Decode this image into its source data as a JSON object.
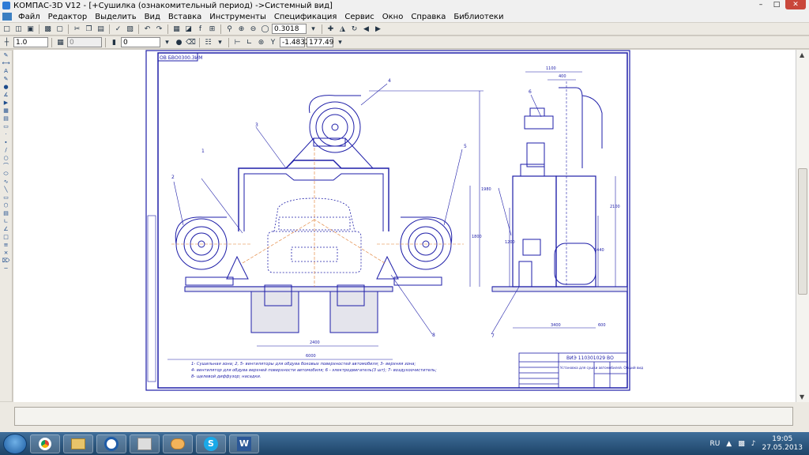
{
  "window": {
    "title": "КОМПАС-3D V12 - [+Сушилка (ознакомительный период) ->Системный вид]"
  },
  "menu": [
    "Файл",
    "Редактор",
    "Выделить",
    "Вид",
    "Вставка",
    "Инструменты",
    "Спецификация",
    "Сервис",
    "Окно",
    "Справка",
    "Библиотеки"
  ],
  "toolbar": {
    "zoom_value": "0.3018"
  },
  "properties_bar": {
    "step_value": "1.0",
    "layer_value": "0",
    "style_value": "0",
    "coord_x": "-1.4832",
    "coord_y": "177.49"
  },
  "drawing": {
    "stamp_code": "ВИЭ 110301029 ВО",
    "corner_code": "ОВ БВО0300.ЗИМ",
    "dims": [
      "1100",
      "400",
      "2100",
      "1440",
      "2400",
      "6000",
      "1980",
      "1800",
      "1200",
      "600",
      "3400"
    ],
    "callouts": [
      "1",
      "2",
      "3",
      "4",
      "5",
      "6",
      "7",
      "8"
    ],
    "notes": [
      "1- Сушильная зона; 2, 5- вентиляторы для обдува боковых поверхностей автомобиля; 3- верхняя зона;",
      "4- вентилятор для обдува верхней поверхности автомобиля; 6 - электродвигатель(3 шт); 7- воздухоочиститель;",
      "8- щелевой диффузор; насадки."
    ],
    "title_block_name": "Установка для сушки автомобилей. Общий вид"
  },
  "taskbar": {
    "apps": [
      "chrome",
      "explorer",
      "kompas",
      "hp",
      "paint",
      "skype",
      "word"
    ],
    "language": "RU",
    "time": "19:05",
    "date": "27.05.2013"
  },
  "colors": {
    "drawing_line": "#1e1ea8",
    "axis_line": "#e07a2a",
    "sheet_bg": "#ffffff"
  }
}
